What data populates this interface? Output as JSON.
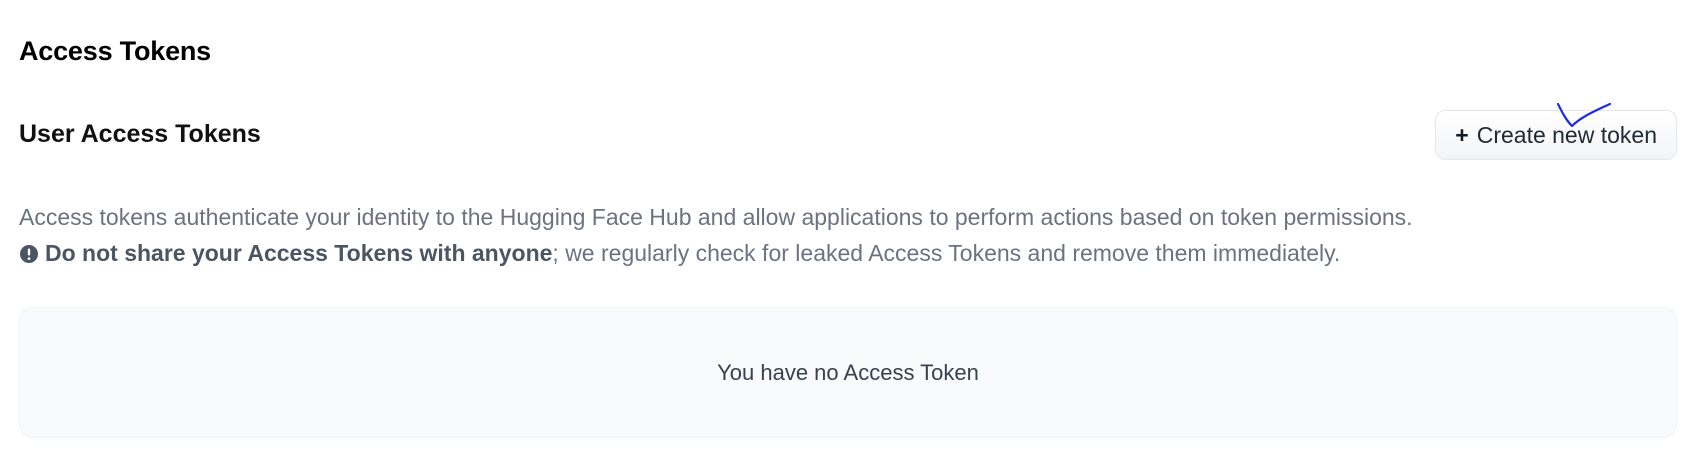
{
  "page": {
    "title": "Access Tokens"
  },
  "section": {
    "title": "User Access Tokens",
    "create_button": {
      "icon": "plus-icon",
      "label": "Create new token"
    }
  },
  "description": {
    "line1": "Access tokens authenticate your identity to the Hugging Face Hub and allow applications to perform actions based on token permissions.",
    "warning_icon": "exclamation-circle-icon",
    "warning_part1": "Do not share your ",
    "warning_bold": "Access Tokens",
    "warning_part2": " with anyone",
    "warning_rest": "; we regularly check for leaked Access Tokens and remove them immediately."
  },
  "tokens": {
    "empty_message": "You have no Access Token"
  },
  "colors": {
    "annotation_mark": "#1d2be0",
    "muted_text": "#6b7280",
    "panel_background": "#f9fafb"
  }
}
